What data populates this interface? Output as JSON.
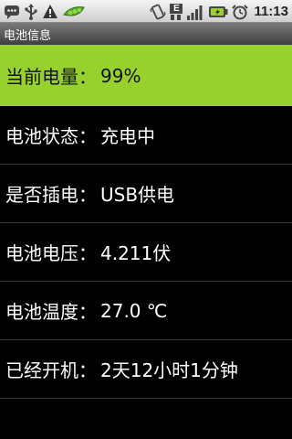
{
  "status_bar": {
    "left_icons": [
      "chat-icon",
      "usb-icon",
      "warning-icon",
      "pea-pod-icon"
    ],
    "right_icons": [
      "vibrate-icon",
      "data-signal-icon",
      "signal-strength-icon",
      "battery-charging-icon",
      "alarm-clock-icon"
    ],
    "data_type_label": "E",
    "time": "11:13"
  },
  "title": "电池信息",
  "rows": [
    {
      "label": "当前电量：",
      "value": "99%"
    },
    {
      "label": "电池状态：",
      "value": "充电中"
    },
    {
      "label": "是否插电：",
      "value": "USB供电"
    },
    {
      "label": "电池电压：",
      "value": "4.211伏"
    },
    {
      "label": "电池温度：",
      "value": "27.0 ℃"
    },
    {
      "label": "已经开机：",
      "value": "2天12小时1分钟"
    }
  ],
  "colors": {
    "highlight": "#97d12d",
    "background": "#000000",
    "title_bar": "#5a5a5a"
  }
}
